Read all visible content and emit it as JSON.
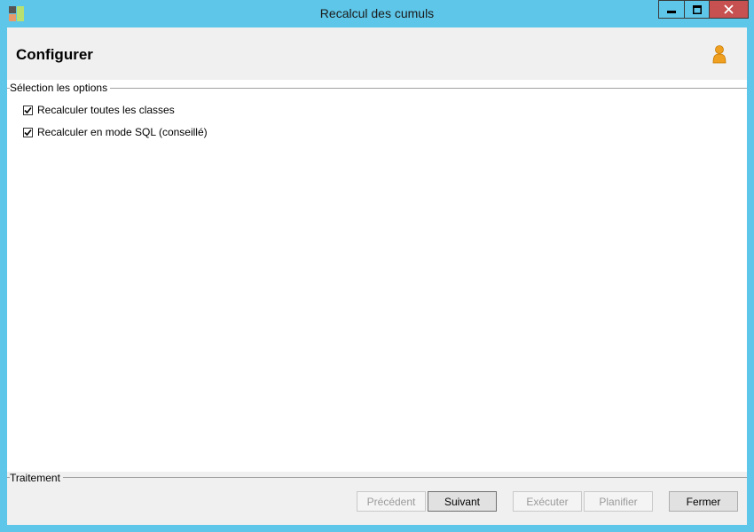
{
  "window": {
    "title": "Recalcul des cumuls",
    "controls": {
      "minimize": "minimize",
      "maximize": "maximize",
      "close": "close"
    }
  },
  "header": {
    "title": "Configurer",
    "icon": "user-icon"
  },
  "options_group": {
    "label": "Sélection les options",
    "items": [
      {
        "label": "Recalculer toutes les classes",
        "checked": true
      },
      {
        "label": "Recalculer en mode SQL (conseillé)",
        "checked": true
      }
    ]
  },
  "treatment_group": {
    "label": "Traitement"
  },
  "buttons": {
    "previous": "Précédent",
    "next": "Suivant",
    "execute": "Exécuter",
    "schedule": "Planifier",
    "close": "Fermer"
  },
  "colors": {
    "titlebar": "#5ec6e8",
    "close_button": "#c75050",
    "header_bg": "#f0f0f0",
    "user_icon": "#f0a020"
  }
}
